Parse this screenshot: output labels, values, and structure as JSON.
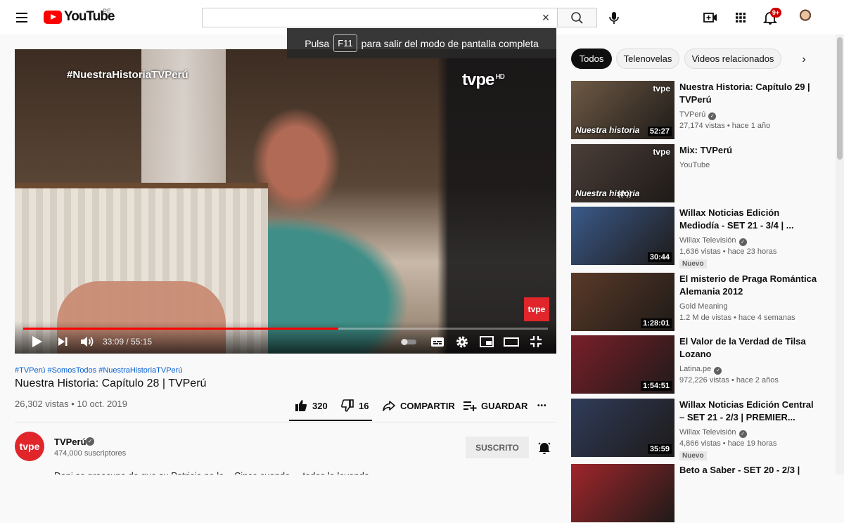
{
  "header": {
    "logo_text": "YouTube",
    "logo_country": "PE",
    "search_value": "",
    "clear_glyph": "×",
    "notification_count": "9+",
    "icons": [
      "menu-icon",
      "search-icon",
      "mic-icon",
      "create-video-icon",
      "apps-icon",
      "bell-icon"
    ]
  },
  "toast": {
    "before": "Pulsa",
    "key": "F11",
    "after": "para salir del modo de pantalla completa"
  },
  "player": {
    "overlay_hashtag": "#NuestraHistoriaTVPerú",
    "watermark": "tvpe",
    "watermark_hd": "HD",
    "corner_logo": "tvpe",
    "current_time": "33:09",
    "duration": "55:15",
    "time_display": "33:09 / 55:15",
    "progress_fraction": 0.6
  },
  "video": {
    "hashtags": "#TVPerú #SomosTodos #NuestraHistoriaTVPerú",
    "title": "Nuestra Historia: Capítulo 28 | TVPerú",
    "meta": "26,302 vistas • 10 oct. 2019",
    "likes": "320",
    "dislikes": "16",
    "share_label": "COMPARTIR",
    "save_label": "GUARDAR",
    "more_glyph": "•••"
  },
  "channel": {
    "avatar_text": "tvpe",
    "name": "TVPerú",
    "subscribers": "474,000 suscriptores",
    "subscribed_label": "SUSCRITO",
    "description": "Dani se preocupa de que su Patricia no le... Cinco cuando ... todos la leyenda"
  },
  "chips": [
    "Todos",
    "Telenovelas",
    "Videos relacionados"
  ],
  "recommendations": [
    {
      "title": "Nuestra Historia: Capítulo 29 | TVPerú",
      "channel": "TVPerú",
      "verified": true,
      "meta": "27,174 vistas • hace 1 año",
      "duration": "52:27",
      "badge": "",
      "thumb_color": "#6e5a45",
      "thumb_label": "Nuestra historia",
      "thumb_brand": "tvpe"
    },
    {
      "title": "Mix: TVPerú",
      "channel": "YouTube",
      "verified": false,
      "meta": "",
      "duration": "",
      "badge": "",
      "thumb_color": "#4b3e38",
      "thumb_label": "Nuestra historia",
      "thumb_brand": "tvpe",
      "live_glyph": "((•))"
    },
    {
      "title": "Willax Noticias Edición Mediodía - SET 21 - 3/4 | ...",
      "channel": "Willax Televisión",
      "verified": true,
      "meta": "1,636 vistas • hace 23 horas",
      "duration": "30:44",
      "badge": "Nuevo",
      "thumb_color": "#3a5a8a",
      "thumb_label": "",
      "thumb_brand": ""
    },
    {
      "title": "El misterio de Praga Romántica Alemania 2012",
      "channel": "Gold Meaning",
      "verified": false,
      "meta": "1.2 M de vistas • hace 4 semanas",
      "duration": "1:28:01",
      "badge": "",
      "thumb_color": "#5a3a28",
      "thumb_label": "",
      "thumb_brand": ""
    },
    {
      "title": "El Valor de la Verdad de Tilsa Lozano",
      "channel": "Latina.pe",
      "verified": true,
      "meta": "972,226 vistas • hace 2 años",
      "duration": "1:54:51",
      "badge": "",
      "thumb_color": "#7a1f2a",
      "thumb_label": "",
      "thumb_brand": ""
    },
    {
      "title": "Willax Noticias Edición Central – SET 21 - 2/3 | PREMIER...",
      "channel": "Willax Televisión",
      "verified": true,
      "meta": "4,866 vistas • hace 19 horas",
      "duration": "35:59",
      "badge": "Nuevo",
      "thumb_color": "#2f3c5a",
      "thumb_label": "",
      "thumb_brand": ""
    },
    {
      "title": "Beto a Saber - SET 20 - 2/3 |",
      "channel": "",
      "verified": false,
      "meta": "",
      "duration": "",
      "badge": "",
      "thumb_color": "#a0262c",
      "thumb_label": "",
      "thumb_brand": ""
    }
  ],
  "colors": {
    "brand_red": "#ff0000",
    "tvpe_red": "#e0262b",
    "link_blue": "#065fd4"
  }
}
